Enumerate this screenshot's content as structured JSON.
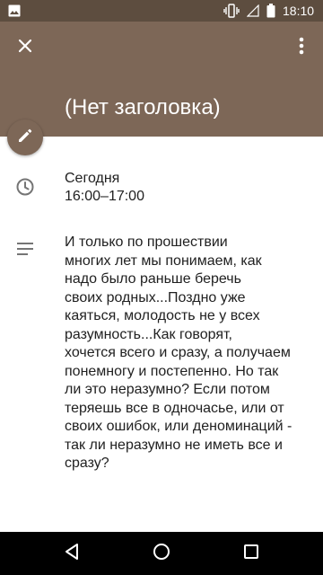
{
  "status_bar": {
    "time": "18:10",
    "icons": [
      "image-icon",
      "vibrate-icon",
      "signal-icon",
      "battery-icon"
    ]
  },
  "toolbar": {
    "close_icon": "close-icon",
    "menu_icon": "more-vert-icon"
  },
  "event": {
    "title": "(Нет заголовка)",
    "day": "Сегодня",
    "time_range": "16:00–17:00",
    "description": "И только по прошествии\nмногих лет мы понимаем, как\nнадо было раньше беречь\nсвоих родных...Поздно уже\nкаяться, молодость не у всех\nразумность...Как говорят,\nхочется всего и сразу, а получаем\nпонемногу и постепенно. Но так\nли это неразумно? Если потом\nтеряешь все в одночасье, или от\nсвоих ошибок, или деноминаций -\nтак ли неразумно не иметь все и\nсразу?"
  },
  "colors": {
    "header": "#7d6757",
    "status_bar": "#5d4d3f",
    "icon_gray": "#757575"
  },
  "navigation": [
    "back-icon",
    "home-icon",
    "recents-icon"
  ]
}
